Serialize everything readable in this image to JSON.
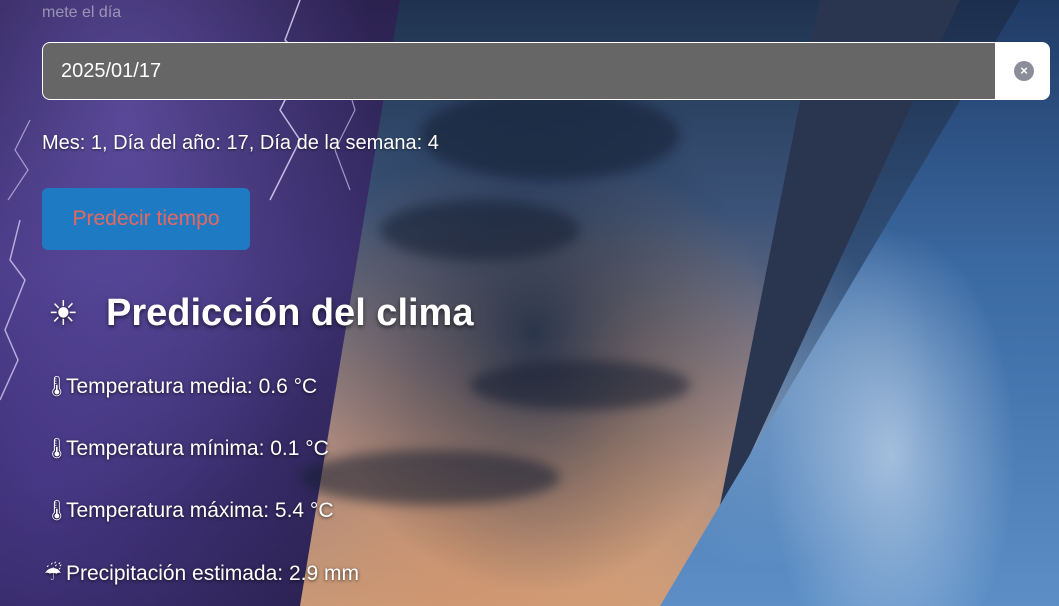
{
  "form": {
    "date_label": "mete el día",
    "date_value": "2025/01/17",
    "clear_symbol": "×"
  },
  "date_info": "Mes: 1, Día del año: 17, Día de la semana: 4",
  "predict_button": {
    "label": "Predecir tiempo"
  },
  "forecast": {
    "title": "Predicción del clima",
    "title_icon": "☀",
    "metrics": [
      {
        "icon": "🌡",
        "icon_name": "thermometer-icon",
        "text": "Temperatura media: 0.6 °C"
      },
      {
        "icon": "🌡",
        "icon_name": "thermometer-icon",
        "text": "Temperatura mínima: 0.1 °C"
      },
      {
        "icon": "🌡",
        "icon_name": "thermometer-icon",
        "text": "Temperatura máxima: 5.4 °C"
      },
      {
        "icon": "☔",
        "icon_name": "rain-cloud-icon",
        "text": "Precipitación estimada: 2.9 mm"
      }
    ]
  },
  "colors": {
    "input_bg": "#666666",
    "button_bg": "#1f7ac4",
    "button_text": "#e8675d",
    "clear_button": "#8b8d98"
  }
}
